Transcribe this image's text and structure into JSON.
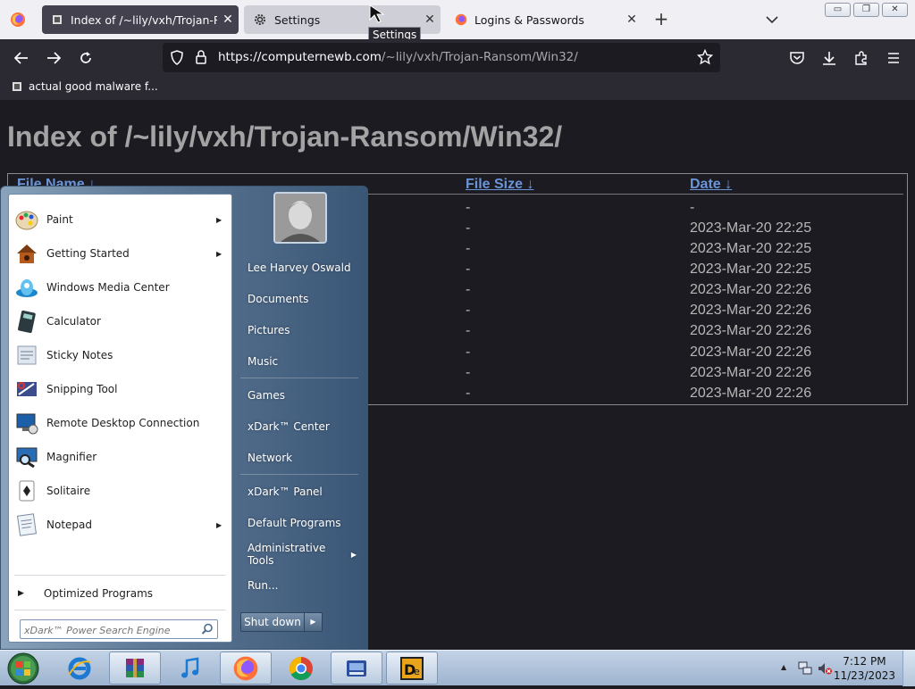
{
  "browser": {
    "tabs": [
      {
        "title": "Index of /~lily/vxh/Trojan-Ransom/Win32/",
        "active": true
      },
      {
        "title": "Settings",
        "active": false
      },
      {
        "title": "Logins & Passwords",
        "active": false
      }
    ],
    "tooltip": "Settings",
    "url": {
      "host": "https://computernewb.com",
      "path": "/~lily/vxh/Trojan-Ransom/Win32/"
    },
    "bookmarks": [
      {
        "label": "actual good malware f..."
      }
    ]
  },
  "page": {
    "heading": "Index of /~lily/vxh/Trojan-Ransom/Win32/",
    "columns": {
      "name": "File Name",
      "size": "File Size",
      "date": "Date",
      "sort_arrow": "↓"
    },
    "rows": [
      {
        "size": "-",
        "date": "-"
      },
      {
        "size": "-",
        "date": "2023-Mar-20 22:25"
      },
      {
        "size": "-",
        "date": "2023-Mar-20 22:25"
      },
      {
        "size": "-",
        "date": "2023-Mar-20 22:25"
      },
      {
        "size": "-",
        "date": "2023-Mar-20 22:26"
      },
      {
        "size": "-",
        "date": "2023-Mar-20 22:26"
      },
      {
        "size": "-",
        "date": "2023-Mar-20 22:26"
      },
      {
        "size": "-",
        "date": "2023-Mar-20 22:26"
      },
      {
        "size": "-",
        "date": "2023-Mar-20 22:26"
      },
      {
        "size": "-",
        "date": "2023-Mar-20 22:26"
      }
    ]
  },
  "start_menu": {
    "programs": [
      {
        "label": "Paint",
        "submenu": true,
        "icon": "paint-icon"
      },
      {
        "label": "Getting Started",
        "submenu": true,
        "icon": "getting-started-icon"
      },
      {
        "label": "Windows Media Center",
        "submenu": false,
        "icon": "media-center-icon"
      },
      {
        "label": "Calculator",
        "submenu": false,
        "icon": "calculator-icon"
      },
      {
        "label": "Sticky Notes",
        "submenu": false,
        "icon": "sticky-notes-icon"
      },
      {
        "label": "Snipping Tool",
        "submenu": false,
        "icon": "snipping-tool-icon"
      },
      {
        "label": "Remote Desktop Connection",
        "submenu": false,
        "icon": "remote-desktop-icon"
      },
      {
        "label": "Magnifier",
        "submenu": false,
        "icon": "magnifier-icon"
      },
      {
        "label": "Solitaire",
        "submenu": false,
        "icon": "solitaire-icon"
      },
      {
        "label": "Notepad",
        "submenu": true,
        "icon": "notepad-icon"
      }
    ],
    "all_programs": "Optimized Programs",
    "search_placeholder": "xDark™ Power Search Engine",
    "user_name": "Lee Harvey Oswald",
    "right_items": [
      "Documents",
      "Pictures",
      "Music",
      "Games",
      "xDark™ Center",
      "Network",
      "xDark™ Panel",
      "Default Programs",
      "Administrative Tools",
      "Run..."
    ],
    "shutdown_label": "Shut down"
  },
  "taskbar": {
    "apps": [
      "internet-explorer-icon",
      "winrar-icon",
      "music-icon",
      "firefox-icon",
      "chrome-icon",
      "xp-app-icon",
      "dexter-icon"
    ],
    "time": "7:12 PM",
    "date": "11/23/2023"
  },
  "colors": {
    "page_bg": "#1c1b22",
    "link": "#6a95d8",
    "text": "#b7b7b7",
    "active_tab": "#42414d"
  }
}
